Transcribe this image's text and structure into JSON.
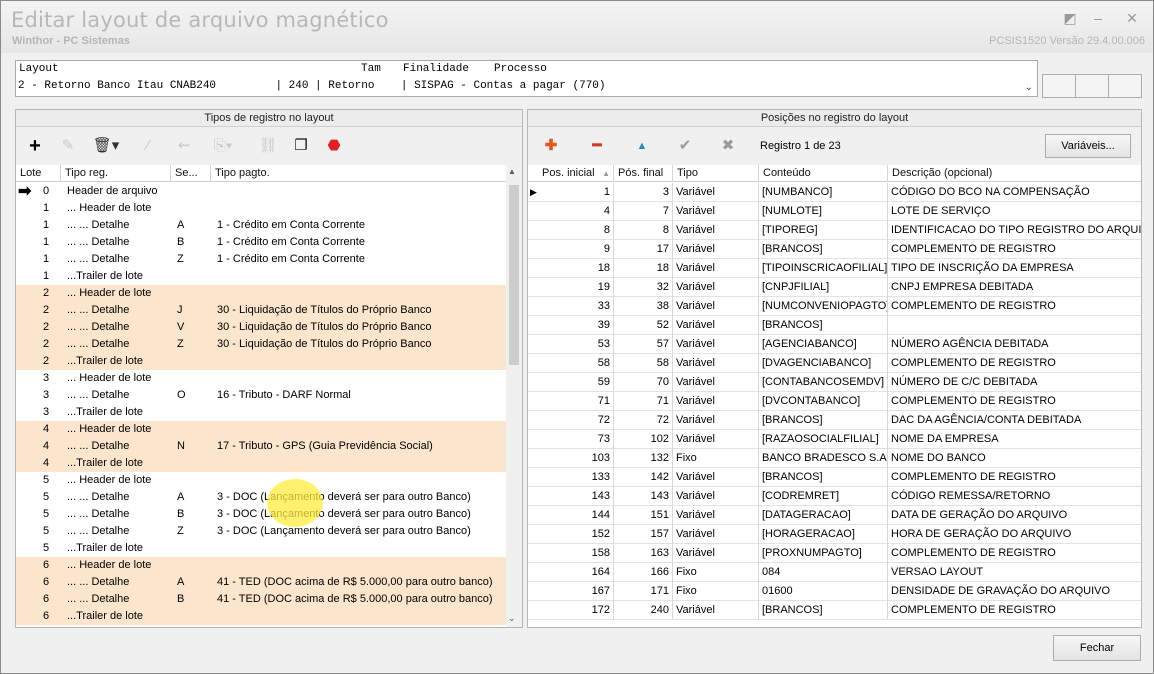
{
  "window": {
    "title": "Editar layout de arquivo magnético",
    "subtitle": "Winthor - PC Sistemas",
    "version": "PCSIS1520  Versão  29.4.00.006"
  },
  "layout": {
    "headers": {
      "layout": "Layout",
      "tam": "Tam",
      "finalidade": "Finalidade",
      "processo": "Processo"
    },
    "value": "2 - Retorno Banco Itau CNAB240         | 240 | Retorno    | SISPAG - Contas a pagar (770)"
  },
  "left_panel": {
    "title": "Tipos de registro no layout",
    "columns": [
      "Lote",
      "Tipo reg.",
      "Se...",
      "Tipo pagto."
    ],
    "rows": [
      {
        "lote": "0",
        "tipo": "Header de arquivo",
        "seg": "",
        "pagto": "",
        "hl": false,
        "arrow": true
      },
      {
        "lote": "1",
        "tipo": "... Header de lote",
        "seg": "",
        "pagto": "",
        "hl": false
      },
      {
        "lote": "1",
        "tipo": "... ... Detalhe",
        "seg": "A",
        "pagto": "1 - Crédito em Conta Corrente",
        "hl": false
      },
      {
        "lote": "1",
        "tipo": "... ... Detalhe",
        "seg": "B",
        "pagto": "1 - Crédito em Conta Corrente",
        "hl": false
      },
      {
        "lote": "1",
        "tipo": "... ... Detalhe",
        "seg": "Z",
        "pagto": "1 - Crédito em Conta Corrente",
        "hl": false
      },
      {
        "lote": "1",
        "tipo": "...Trailer de lote",
        "seg": "",
        "pagto": "",
        "hl": false
      },
      {
        "lote": "2",
        "tipo": "... Header de lote",
        "seg": "",
        "pagto": "",
        "hl": true
      },
      {
        "lote": "2",
        "tipo": "... ... Detalhe",
        "seg": "J",
        "pagto": "30 - Liquidação de Títulos do Próprio Banco",
        "hl": true
      },
      {
        "lote": "2",
        "tipo": "... ... Detalhe",
        "seg": "V",
        "pagto": "30 - Liquidação de Títulos do Próprio Banco",
        "hl": true
      },
      {
        "lote": "2",
        "tipo": "... ... Detalhe",
        "seg": "Z",
        "pagto": "30 - Liquidação de Títulos do Próprio Banco",
        "hl": true
      },
      {
        "lote": "2",
        "tipo": "...Trailer de lote",
        "seg": "",
        "pagto": "",
        "hl": true
      },
      {
        "lote": "3",
        "tipo": "... Header de lote",
        "seg": "",
        "pagto": "",
        "hl": false
      },
      {
        "lote": "3",
        "tipo": "... ... Detalhe",
        "seg": "O",
        "pagto": "16 - Tributo - DARF Normal",
        "hl": false
      },
      {
        "lote": "3",
        "tipo": "...Trailer de lote",
        "seg": "",
        "pagto": "",
        "hl": false
      },
      {
        "lote": "4",
        "tipo": "... Header de lote",
        "seg": "",
        "pagto": "",
        "hl": true
      },
      {
        "lote": "4",
        "tipo": "... ... Detalhe",
        "seg": "N",
        "pagto": "17 - Tributo - GPS (Guia Previdência Social)",
        "hl": true
      },
      {
        "lote": "4",
        "tipo": "...Trailer de lote",
        "seg": "",
        "pagto": "",
        "hl": true
      },
      {
        "lote": "5",
        "tipo": "... Header de lote",
        "seg": "",
        "pagto": "",
        "hl": false
      },
      {
        "lote": "5",
        "tipo": "... ... Detalhe",
        "seg": "A",
        "pagto": "3 - DOC (Lançamento deverá ser para outro Banco)",
        "hl": false
      },
      {
        "lote": "5",
        "tipo": "... ... Detalhe",
        "seg": "B",
        "pagto": "3 - DOC (Lançamento deverá ser para outro Banco)",
        "hl": false
      },
      {
        "lote": "5",
        "tipo": "... ... Detalhe",
        "seg": "Z",
        "pagto": "3 - DOC (Lançamento deverá ser para outro Banco)",
        "hl": false
      },
      {
        "lote": "5",
        "tipo": "...Trailer de lote",
        "seg": "",
        "pagto": "",
        "hl": false
      },
      {
        "lote": "6",
        "tipo": "... Header de lote",
        "seg": "",
        "pagto": "",
        "hl": true
      },
      {
        "lote": "6",
        "tipo": "... ... Detalhe",
        "seg": "A",
        "pagto": "41 - TED (DOC acima de R$ 5.000,00 para outro banco)",
        "hl": true
      },
      {
        "lote": "6",
        "tipo": "... ... Detalhe",
        "seg": "B",
        "pagto": "41 - TED (DOC acima de R$ 5.000,00 para outro banco)",
        "hl": true
      },
      {
        "lote": "6",
        "tipo": "...Trailer de lote",
        "seg": "",
        "pagto": "",
        "hl": true
      }
    ]
  },
  "right_panel": {
    "title": "Posições no registro do layout",
    "registro": "Registro 1 de 23",
    "variaveis_label": "Variáveis...",
    "columns": [
      "Pos. inicial",
      "Pós. final",
      "Tipo",
      "Conteúdo",
      "Descrição (opcional)"
    ],
    "rows": [
      [
        "1",
        "3",
        "Variável",
        "[NUMBANCO]",
        "CÓDIGO DO BCO NA COMPENSAÇÃO"
      ],
      [
        "4",
        "7",
        "Variável",
        "[NUMLOTE]",
        "LOTE DE SERVIÇO"
      ],
      [
        "8",
        "8",
        "Variável",
        "[TIPOREG]",
        "IDENTIFICACAO DO TIPO REGISTRO DO ARQUIVO"
      ],
      [
        "9",
        "17",
        "Variável",
        "[BRANCOS]",
        "COMPLEMENTO DE REGISTRO"
      ],
      [
        "18",
        "18",
        "Variável",
        "[TIPOINSCRICAOFILIAL]",
        "TIPO DE INSCRIÇÃO DA EMPRESA"
      ],
      [
        "19",
        "32",
        "Variável",
        "[CNPJFILIAL]",
        "CNPJ EMPRESA DEBITADA"
      ],
      [
        "33",
        "38",
        "Variável",
        "[NUMCONVENIOPAGTO]",
        "COMPLEMENTO DE REGISTRO"
      ],
      [
        "39",
        "52",
        "Variável",
        "[BRANCOS]",
        ""
      ],
      [
        "53",
        "57",
        "Variável",
        "[AGENCIABANCO]",
        "NÚMERO AGÊNCIA DEBITADA"
      ],
      [
        "58",
        "58",
        "Variável",
        "[DVAGENCIABANCO]",
        "COMPLEMENTO DE REGISTRO"
      ],
      [
        "59",
        "70",
        "Variável",
        "[CONTABANCOSEMDV]",
        "NÚMERO DE C/C DEBITADA"
      ],
      [
        "71",
        "71",
        "Variável",
        "[DVCONTABANCO]",
        "COMPLEMENTO DE REGISTRO"
      ],
      [
        "72",
        "72",
        "Variável",
        "[BRANCOS]",
        "DAC DA AGÊNCIA/CONTA DEBITADA"
      ],
      [
        "73",
        "102",
        "Variável",
        "[RAZAOSOCIALFILIAL]",
        "NOME DA EMPRESA"
      ],
      [
        "103",
        "132",
        "Fixo",
        "BANCO BRADESCO S.A.",
        "NOME DO BANCO"
      ],
      [
        "133",
        "142",
        "Variável",
        "[BRANCOS]",
        "COMPLEMENTO DE REGISTRO"
      ],
      [
        "143",
        "143",
        "Variável",
        "[CODREMRET]",
        "CÓDIGO REMESSA/RETORNO"
      ],
      [
        "144",
        "151",
        "Variável",
        "[DATAGERACAO]",
        "DATA DE GERAÇÃO DO ARQUIVO"
      ],
      [
        "152",
        "157",
        "Variável",
        "[HORAGERACAO]",
        "HORA DE GERAÇÃO DO ARQUIVO"
      ],
      [
        "158",
        "163",
        "Variável",
        "[PROXNUMPAGTO]",
        "COMPLEMENTO DE REGISTRO"
      ],
      [
        "164",
        "166",
        "Fixo",
        "084",
        "VERSAO LAYOUT"
      ],
      [
        "167",
        "171",
        "Fixo",
        "01600",
        "DENSIDADE DE GRAVAÇÃO DO ARQUIVO"
      ],
      [
        "172",
        "240",
        "Variável",
        "[BRANCOS]",
        "COMPLEMENTO DE REGISTRO"
      ]
    ]
  },
  "footer": {
    "close_label": "Fechar"
  },
  "colors": {
    "row_highlight": "#fbe5cc",
    "add_icon": "#e8541e",
    "remove_icon": "#d9362b",
    "up_icon": "#2d8bc9",
    "alert_icon": "#e02020"
  }
}
